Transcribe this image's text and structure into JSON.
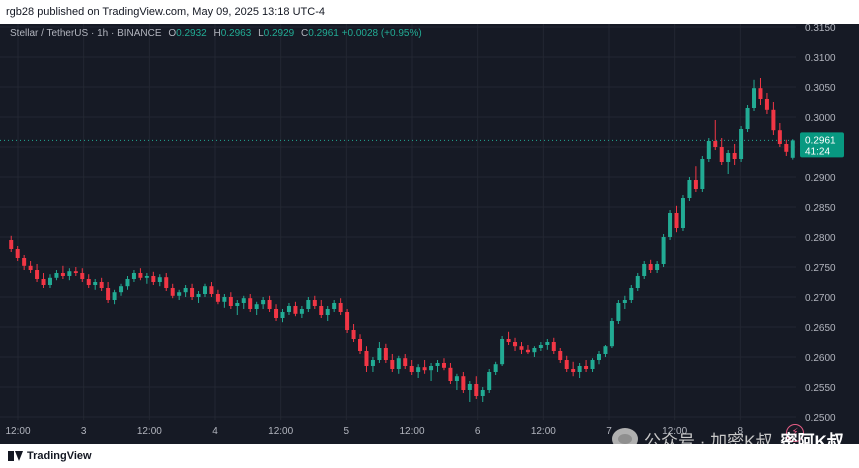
{
  "header": {
    "published_text": "rgb28 published on TradingView.com, May 09, 2025 13:18 UTC-4"
  },
  "legend": {
    "symbol": "Stellar / TetherUS · 1h · BINANCE",
    "open_label": "O",
    "open": "0.2932",
    "high_label": "H",
    "high": "0.2963",
    "low_label": "L",
    "low": "0.2929",
    "close_label": "C",
    "close": "0.2961",
    "change": "+0.0028 (+0.95%)"
  },
  "price_tag": {
    "price": "0.2961",
    "countdown": "41:24"
  },
  "footer": {
    "brand": "TradingView"
  },
  "watermark": {
    "text": "公众号 · 加密K叔",
    "dark_text": "密阿K叔"
  },
  "colors": {
    "up": "#22ab94",
    "down": "#f23645",
    "background": "#161a25",
    "grid": "#232732",
    "axis_text": "#b2b5be"
  },
  "chart_data": {
    "type": "candlestick",
    "title": "Stellar / TetherUS · 1h · BINANCE",
    "ylim": [
      0.2495,
      0.3155
    ],
    "y_ticks": [
      "0.3150",
      "0.3100",
      "0.3050",
      "0.3000",
      "0.2950",
      "0.2900",
      "0.2850",
      "0.2800",
      "0.2750",
      "0.2700",
      "0.2650",
      "0.2600",
      "0.2550",
      "0.2500"
    ],
    "x_ticks": [
      "12:00",
      "3",
      "12:00",
      "4",
      "12:00",
      "5",
      "12:00",
      "6",
      "12:00",
      "7",
      "12:00",
      "8"
    ],
    "last_price": 0.2961,
    "candles": [
      [
        0.2795,
        0.2802,
        0.2775,
        0.278
      ],
      [
        0.278,
        0.2785,
        0.276,
        0.2765
      ],
      [
        0.2765,
        0.277,
        0.2745,
        0.2752
      ],
      [
        0.2752,
        0.276,
        0.274,
        0.2745
      ],
      [
        0.2745,
        0.2755,
        0.2725,
        0.273
      ],
      [
        0.273,
        0.274,
        0.2715,
        0.272
      ],
      [
        0.272,
        0.2738,
        0.2715,
        0.2732
      ],
      [
        0.2732,
        0.2745,
        0.2728,
        0.274
      ],
      [
        0.274,
        0.2752,
        0.273,
        0.2735
      ],
      [
        0.2735,
        0.2748,
        0.2728,
        0.2743
      ],
      [
        0.2743,
        0.275,
        0.2735,
        0.274
      ],
      [
        0.274,
        0.2748,
        0.2725,
        0.273
      ],
      [
        0.273,
        0.2738,
        0.2715,
        0.272
      ],
      [
        0.272,
        0.273,
        0.2712,
        0.2725
      ],
      [
        0.2725,
        0.2732,
        0.271,
        0.2715
      ],
      [
        0.2715,
        0.2725,
        0.269,
        0.2695
      ],
      [
        0.2695,
        0.2712,
        0.2688,
        0.2708
      ],
      [
        0.2708,
        0.2722,
        0.2702,
        0.2718
      ],
      [
        0.2718,
        0.2735,
        0.2712,
        0.273
      ],
      [
        0.273,
        0.2745,
        0.2725,
        0.274
      ],
      [
        0.274,
        0.2748,
        0.2728,
        0.2732
      ],
      [
        0.2732,
        0.274,
        0.2722,
        0.2735
      ],
      [
        0.2735,
        0.2742,
        0.272,
        0.2725
      ],
      [
        0.2725,
        0.2738,
        0.2718,
        0.2733
      ],
      [
        0.2733,
        0.274,
        0.271,
        0.2715
      ],
      [
        0.2715,
        0.2722,
        0.2698,
        0.2702
      ],
      [
        0.2702,
        0.2712,
        0.2695,
        0.2708
      ],
      [
        0.2708,
        0.272,
        0.27,
        0.2715
      ],
      [
        0.2715,
        0.2722,
        0.2695,
        0.27
      ],
      [
        0.27,
        0.271,
        0.269,
        0.2705
      ],
      [
        0.2705,
        0.2722,
        0.27,
        0.2718
      ],
      [
        0.2718,
        0.2725,
        0.27,
        0.2705
      ],
      [
        0.2705,
        0.2712,
        0.2688,
        0.2692
      ],
      [
        0.2692,
        0.2705,
        0.2682,
        0.27
      ],
      [
        0.27,
        0.2708,
        0.268,
        0.2685
      ],
      [
        0.2685,
        0.2695,
        0.267,
        0.269
      ],
      [
        0.269,
        0.2702,
        0.268,
        0.2698
      ],
      [
        0.2698,
        0.2705,
        0.2675,
        0.268
      ],
      [
        0.268,
        0.2692,
        0.267,
        0.2688
      ],
      [
        0.2688,
        0.27,
        0.268,
        0.2695
      ],
      [
        0.2695,
        0.2702,
        0.2675,
        0.268
      ],
      [
        0.268,
        0.2688,
        0.266,
        0.2665
      ],
      [
        0.2665,
        0.268,
        0.2658,
        0.2675
      ],
      [
        0.2675,
        0.269,
        0.267,
        0.2685
      ],
      [
        0.2685,
        0.2692,
        0.2668,
        0.2672
      ],
      [
        0.2672,
        0.2685,
        0.2665,
        0.268
      ],
      [
        0.268,
        0.27,
        0.2675,
        0.2695
      ],
      [
        0.2695,
        0.2702,
        0.268,
        0.2685
      ],
      [
        0.2685,
        0.2695,
        0.2665,
        0.267
      ],
      [
        0.267,
        0.2685,
        0.266,
        0.268
      ],
      [
        0.268,
        0.2695,
        0.2675,
        0.269
      ],
      [
        0.269,
        0.2698,
        0.267,
        0.2675
      ],
      [
        0.2675,
        0.268,
        0.264,
        0.2645
      ],
      [
        0.2645,
        0.2655,
        0.2625,
        0.263
      ],
      [
        0.263,
        0.2638,
        0.2605,
        0.261
      ],
      [
        0.261,
        0.2618,
        0.2575,
        0.2585
      ],
      [
        0.2585,
        0.26,
        0.2575,
        0.2595
      ],
      [
        0.2595,
        0.2625,
        0.259,
        0.2615
      ],
      [
        0.2615,
        0.2622,
        0.259,
        0.2595
      ],
      [
        0.2595,
        0.2605,
        0.2575,
        0.258
      ],
      [
        0.258,
        0.2602,
        0.2572,
        0.2598
      ],
      [
        0.2598,
        0.2605,
        0.258,
        0.2585
      ],
      [
        0.2585,
        0.2595,
        0.257,
        0.2575
      ],
      [
        0.2575,
        0.2588,
        0.2565,
        0.2583
      ],
      [
        0.2583,
        0.2595,
        0.2572,
        0.2578
      ],
      [
        0.2578,
        0.259,
        0.256,
        0.2585
      ],
      [
        0.2585,
        0.2595,
        0.2575,
        0.259
      ],
      [
        0.259,
        0.2598,
        0.2578,
        0.2582
      ],
      [
        0.2582,
        0.259,
        0.2555,
        0.256
      ],
      [
        0.256,
        0.2572,
        0.2545,
        0.2568
      ],
      [
        0.2568,
        0.2575,
        0.254,
        0.2545
      ],
      [
        0.2545,
        0.256,
        0.2525,
        0.2555
      ],
      [
        0.2555,
        0.2568,
        0.253,
        0.2535
      ],
      [
        0.2535,
        0.255,
        0.2525,
        0.2545
      ],
      [
        0.2545,
        0.258,
        0.254,
        0.2575
      ],
      [
        0.2575,
        0.2592,
        0.257,
        0.2588
      ],
      [
        0.2588,
        0.2635,
        0.2585,
        0.263
      ],
      [
        0.263,
        0.2642,
        0.262,
        0.2625
      ],
      [
        0.2625,
        0.2632,
        0.261,
        0.2618
      ],
      [
        0.2618,
        0.2625,
        0.2605,
        0.2612
      ],
      [
        0.2612,
        0.262,
        0.2605,
        0.2608
      ],
      [
        0.2608,
        0.2618,
        0.26,
        0.2615
      ],
      [
        0.2615,
        0.2625,
        0.261,
        0.262
      ],
      [
        0.262,
        0.263,
        0.2612,
        0.2625
      ],
      [
        0.2625,
        0.2632,
        0.2605,
        0.261
      ],
      [
        0.261,
        0.2615,
        0.259,
        0.2595
      ],
      [
        0.2595,
        0.2602,
        0.2575,
        0.258
      ],
      [
        0.258,
        0.2592,
        0.2568,
        0.2575
      ],
      [
        0.2575,
        0.259,
        0.2565,
        0.2585
      ],
      [
        0.2585,
        0.2595,
        0.2575,
        0.258
      ],
      [
        0.258,
        0.2598,
        0.2575,
        0.2595
      ],
      [
        0.2595,
        0.261,
        0.2588,
        0.2605
      ],
      [
        0.2605,
        0.262,
        0.26,
        0.2618
      ],
      [
        0.2618,
        0.2665,
        0.2615,
        0.266
      ],
      [
        0.266,
        0.2695,
        0.2655,
        0.269
      ],
      [
        0.269,
        0.2702,
        0.268,
        0.2695
      ],
      [
        0.2695,
        0.272,
        0.269,
        0.2715
      ],
      [
        0.2715,
        0.274,
        0.271,
        0.2735
      ],
      [
        0.2735,
        0.276,
        0.273,
        0.2755
      ],
      [
        0.2755,
        0.2762,
        0.274,
        0.2745
      ],
      [
        0.2745,
        0.276,
        0.274,
        0.2755
      ],
      [
        0.2755,
        0.2805,
        0.275,
        0.28
      ],
      [
        0.28,
        0.2845,
        0.2795,
        0.284
      ],
      [
        0.284,
        0.2852,
        0.2808,
        0.2815
      ],
      [
        0.2815,
        0.287,
        0.281,
        0.2865
      ],
      [
        0.2865,
        0.29,
        0.286,
        0.2895
      ],
      [
        0.2895,
        0.2918,
        0.2875,
        0.288
      ],
      [
        0.288,
        0.2935,
        0.2875,
        0.293
      ],
      [
        0.293,
        0.2965,
        0.2925,
        0.296
      ],
      [
        0.296,
        0.2995,
        0.2945,
        0.295
      ],
      [
        0.295,
        0.2965,
        0.292,
        0.2925
      ],
      [
        0.2925,
        0.2945,
        0.2905,
        0.294
      ],
      [
        0.294,
        0.2955,
        0.292,
        0.293
      ],
      [
        0.293,
        0.2985,
        0.2925,
        0.298
      ],
      [
        0.298,
        0.302,
        0.2975,
        0.3015
      ],
      [
        0.3015,
        0.3062,
        0.301,
        0.3048
      ],
      [
        0.3048,
        0.3065,
        0.302,
        0.303
      ],
      [
        0.303,
        0.304,
        0.3005,
        0.3012
      ],
      [
        0.3012,
        0.3025,
        0.297,
        0.2978
      ],
      [
        0.2978,
        0.299,
        0.295,
        0.2955
      ],
      [
        0.2955,
        0.2962,
        0.2935,
        0.2942
      ],
      [
        0.2932,
        0.2963,
        0.2929,
        0.2961
      ]
    ]
  }
}
